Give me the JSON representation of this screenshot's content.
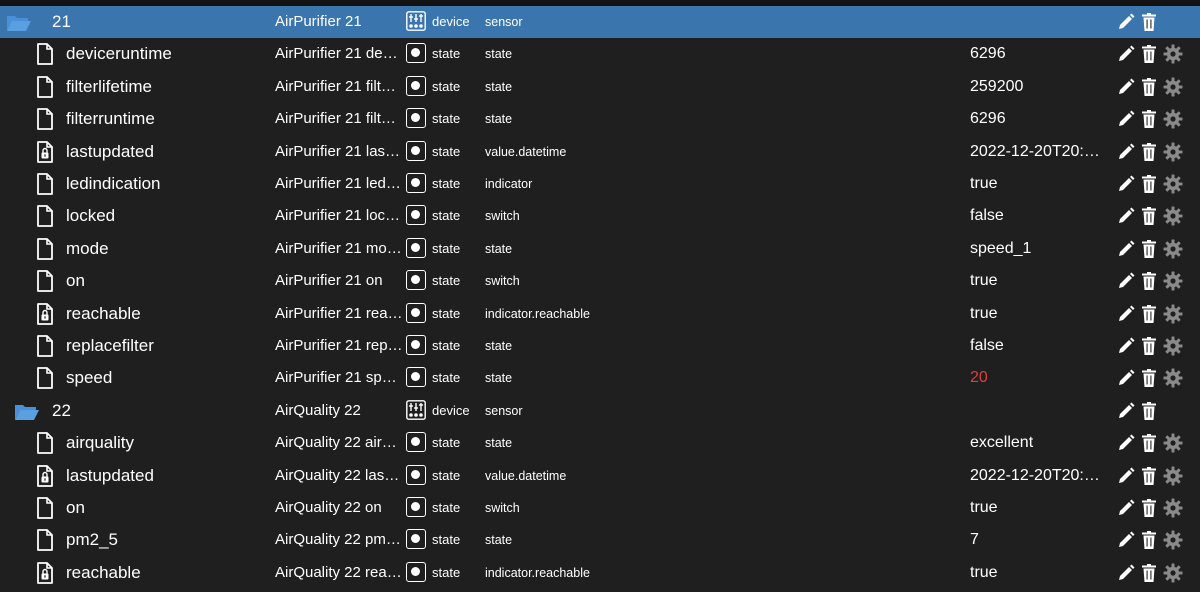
{
  "rows": [
    {
      "kind": "folder",
      "indent": 0,
      "name": "21",
      "object_name": "AirPurifier 21",
      "type": "device",
      "role": "sensor",
      "value": "",
      "selected": true,
      "file_icon": "folder-icon",
      "value_color": ""
    },
    {
      "kind": "state",
      "name": "deviceruntime",
      "object_name": "AirPurifier 21 devic...",
      "type": "state",
      "role": "state",
      "value": "6296",
      "file_icon": "file-icon"
    },
    {
      "kind": "state",
      "name": "filterlifetime",
      "object_name": "AirPurifier 21 filterl...",
      "type": "state",
      "role": "state",
      "value": "259200",
      "file_icon": "file-icon"
    },
    {
      "kind": "state",
      "name": "filterruntime",
      "object_name": "AirPurifier 21 filter...",
      "type": "state",
      "role": "state",
      "value": "6296",
      "file_icon": "file-icon"
    },
    {
      "kind": "state",
      "name": "lastupdated",
      "object_name": "AirPurifier 21 lastu...",
      "type": "state",
      "role": "value.datetime",
      "value": "2022-12-20T20:2...",
      "file_icon": "locked-file-icon"
    },
    {
      "kind": "state",
      "name": "ledindication",
      "object_name": "AirPurifier 21 ledin...",
      "type": "state",
      "role": "indicator",
      "value": "true",
      "file_icon": "file-icon"
    },
    {
      "kind": "state",
      "name": "locked",
      "object_name": "AirPurifier 21 locked",
      "type": "state",
      "role": "switch",
      "value": "false",
      "file_icon": "file-icon"
    },
    {
      "kind": "state",
      "name": "mode",
      "object_name": "AirPurifier 21 mode",
      "type": "state",
      "role": "state",
      "value": "speed_1",
      "file_icon": "file-icon"
    },
    {
      "kind": "state",
      "name": "on",
      "object_name": "AirPurifier 21 on",
      "type": "state",
      "role": "switch",
      "value": "true",
      "file_icon": "file-icon"
    },
    {
      "kind": "state",
      "name": "reachable",
      "object_name": "AirPurifier 21 reac...",
      "type": "state",
      "role": "indicator.reachable",
      "value": "true",
      "file_icon": "locked-file-icon"
    },
    {
      "kind": "state",
      "name": "replacefilter",
      "object_name": "AirPurifier 21 repla...",
      "type": "state",
      "role": "state",
      "value": "false",
      "file_icon": "file-icon"
    },
    {
      "kind": "state",
      "name": "speed",
      "object_name": "AirPurifier 21 speed",
      "type": "state",
      "role": "state",
      "value": "20",
      "file_icon": "file-icon",
      "value_color": "#e0403a"
    },
    {
      "kind": "folder",
      "name": "22",
      "object_name": "AirQuality 22",
      "type": "device",
      "role": "sensor",
      "value": "",
      "file_icon": "folder-icon"
    },
    {
      "kind": "state",
      "name": "airquality",
      "object_name": "AirQuality 22 airqu...",
      "type": "state",
      "role": "state",
      "value": "excellent",
      "file_icon": "file-icon"
    },
    {
      "kind": "state",
      "name": "lastupdated",
      "object_name": "AirQuality 22 lastu...",
      "type": "state",
      "role": "value.datetime",
      "value": "2022-12-20T20:2...",
      "file_icon": "locked-file-icon"
    },
    {
      "kind": "state",
      "name": "on",
      "object_name": "AirQuality 22 on",
      "type": "state",
      "role": "switch",
      "value": "true",
      "file_icon": "file-icon"
    },
    {
      "kind": "state",
      "name": "pm2_5",
      "object_name": "AirQuality 22 pm2_5",
      "type": "state",
      "role": "state",
      "value": "7",
      "file_icon": "file-icon"
    },
    {
      "kind": "state",
      "name": "reachable",
      "object_name": "AirQuality 22 reac...",
      "type": "state",
      "role": "indicator.reachable",
      "value": "true",
      "file_icon": "locked-file-icon"
    }
  ],
  "colors": {
    "background": "#1f1f1f",
    "selected_row": "#3a75ad",
    "folder_blue": "#4a90d9",
    "text": "#ffffff",
    "warning_value": "#e0403a",
    "gear": "#8a8a8a"
  },
  "action_icons": [
    "edit-icon",
    "delete-icon",
    "settings-gear-icon"
  ]
}
